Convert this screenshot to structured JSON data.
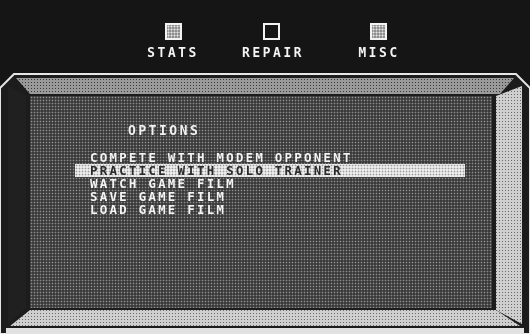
{
  "tabs": [
    {
      "label": "STATS",
      "icon": "dithered-square-icon"
    },
    {
      "label": "REPAIR",
      "icon": "empty-square-icon"
    },
    {
      "label": "MISC",
      "icon": "dithered-square-icon"
    }
  ],
  "panel": {
    "title": "OPTIONS",
    "menu_items": [
      "COMPETE WITH MODEM OPPONENT",
      "PRACTICE WITH SOLO TRAINER",
      "WATCH GAME FILM",
      "SAVE GAME FILM",
      "LOAD GAME FILM"
    ],
    "selected_item": "PRACTICE WITH SOLO TRAINER"
  },
  "colors": {
    "background": "#151515",
    "text": "#f4f4f4",
    "frame_light": "#d8d8d8"
  }
}
